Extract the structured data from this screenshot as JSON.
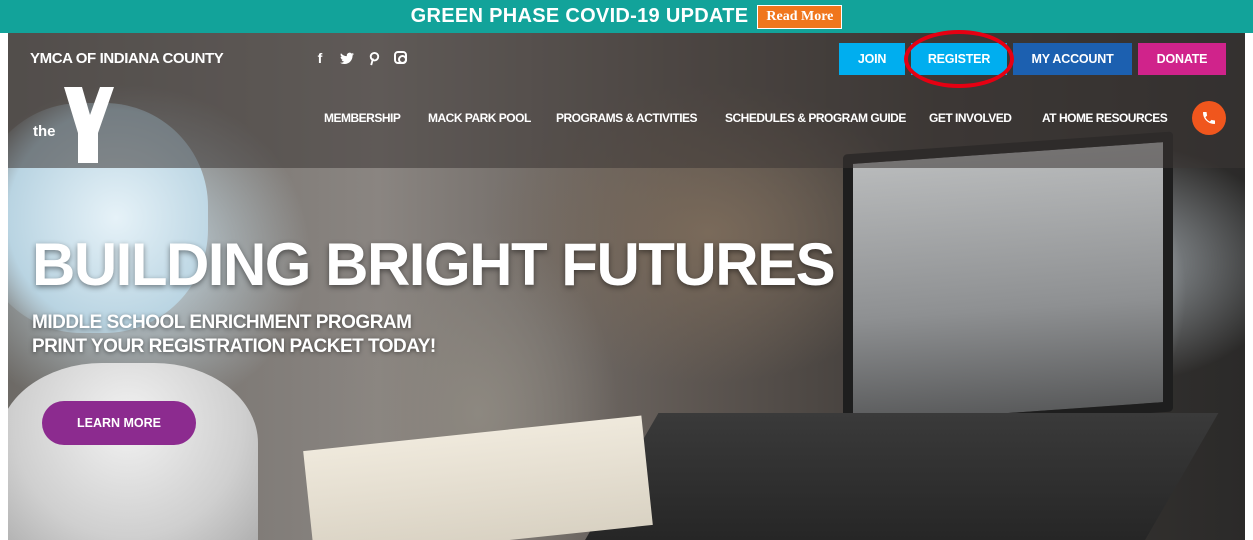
{
  "alert": {
    "text": "GREEN PHASE COVID-19 UPDATE",
    "button": "Read More",
    "bg_color": "#12a39a",
    "button_color": "#f0761d"
  },
  "header": {
    "brand": "YMCA OF INDIANA COUNTY",
    "social": [
      {
        "icon": "facebook-icon",
        "glyph": "f"
      },
      {
        "icon": "twitter-icon",
        "glyph": "🐦"
      },
      {
        "icon": "pinterest-icon",
        "glyph": "p"
      },
      {
        "icon": "instagram-icon",
        "glyph": ""
      }
    ],
    "buttons": {
      "join": "JOIN",
      "register": "REGISTER",
      "account": "MY ACCOUNT",
      "donate": "DONATE"
    },
    "logo_text": "the",
    "nav": [
      "MEMBERSHIP",
      "MACK PARK POOL",
      "PROGRAMS & ACTIVITIES",
      "SCHEDULES & PROGRAM GUIDE",
      "GET INVOLVED",
      "AT HOME RESOURCES"
    ],
    "phone_icon": "phone-icon"
  },
  "hero": {
    "title": "BUILDING BRIGHT FUTURES",
    "subtitle_line1": "MIDDLE SCHOOL ENRICHMENT PROGRAM",
    "subtitle_line2": "PRINT YOUR REGISTRATION PACKET TODAY!",
    "cta": "LEARN MORE",
    "cta_color": "#8c2b8f"
  },
  "colors": {
    "join": "#00aeef",
    "register": "#00aeef",
    "account": "#1c60b0",
    "donate": "#d0238b",
    "phone": "#f0561d",
    "highlight_circle": "#e60012"
  }
}
